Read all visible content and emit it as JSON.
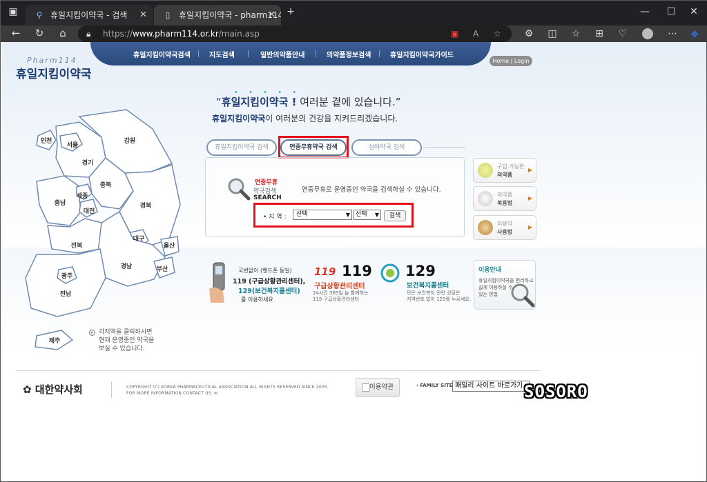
{
  "browser": {
    "tabs": [
      {
        "title": "휴일지킴이약국 - 검색",
        "icon": "search-icon"
      },
      {
        "title": "휴일지킴이약국 - pharm114",
        "icon": "page-icon"
      }
    ],
    "url_prefix": "https://",
    "url_host": "www.pharm114.or.kr",
    "url_path": "/main.asp"
  },
  "site": {
    "logo_small": "Pharm114",
    "logo": "휴일지킴이약국",
    "nav": [
      "휴일지킴이약국검색",
      "지도검색",
      "일반의약품안내",
      "의약품정보검색",
      "휴일지킴이약국가이드"
    ],
    "home_login": "Home | Login"
  },
  "slogan": {
    "line1_brand": "휴일지킴이약국 !",
    "line1_rest": " 여러분 곁에 있습니다.",
    "open_quote": "“",
    "close_quote": "”",
    "line2_brand": "휴일지킴이약국",
    "line2_rest": "이 여러분의 건강을 지켜드리겠습니다."
  },
  "search_tabs": [
    "휴일지킴이약국 검색",
    "연중무휴약국 검색",
    "심야약국 검색"
  ],
  "search": {
    "label1": "연중무휴",
    "label2": "약국검색",
    "label3": "SEARCH",
    "description": "연중무휴로 운영중인 약국을 검색하실 수 있습니다.",
    "region_label": "• 지 역 :",
    "region_value": "선택",
    "subregion_value": "선택",
    "button": "검색"
  },
  "side_cards": [
    {
      "t1": "구입 가능한",
      "t2": "의약품"
    },
    {
      "t1": "의약품",
      "t2": "복용법"
    },
    {
      "t1": "외용약",
      "t2": "사용법"
    }
  ],
  "info": {
    "phone_l1": "국번없이 (핸드폰 동일)",
    "phone_l2": "119 (구급상황관리센터),",
    "phone_l3": "129(보건복지콜센터)",
    "phone_l4": "를 이용하세요",
    "n119": "119",
    "n119_title": "구급상황관리센터",
    "n119_d1": "24시간 365일 늘 함께하는",
    "n119_d2": "119 구급상황관리센터",
    "n129": "129",
    "n129_title": "보건복지콜센터",
    "n129_d1": "모든 보건복지 관련 상담은",
    "n129_d2": "지역번호 없이 129를 누르세요.",
    "guide_title": "이용안내",
    "guide_l1": "휴일지킴이약국을 편리하고",
    "guide_l2": "쉽게 이용하실 수",
    "guide_l3": "있는 방법"
  },
  "regions": [
    "인천",
    "서울",
    "경기",
    "강원",
    "충북",
    "충남",
    "세종",
    "대전",
    "경북",
    "대구",
    "전북",
    "울산",
    "경남",
    "부산",
    "광주",
    "전남",
    "제주"
  ],
  "map_hint": [
    "각지역을 클릭하시면",
    "현재 운영중인 약국을",
    "보실 수 있습니다."
  ],
  "footer": {
    "association": "대한약사회",
    "copyright_l1": "COPYRIGHT (C) KOREA PHARMACEUTICAL ASSOCIATION ALL RIGHTS RESERVED SINCE 2005",
    "copyright_l2": "FOR MORE INFORMATION CONTACT US.",
    "terms": "이용약관",
    "family_label": "› FAMILY SITE",
    "family_select": "패밀리 사이트 바로가기"
  },
  "watermark": "SOSORO",
  "colors": {
    "accent": "#1f3f74",
    "highlight": "#e2111b",
    "nav": "#2b4a7d"
  }
}
